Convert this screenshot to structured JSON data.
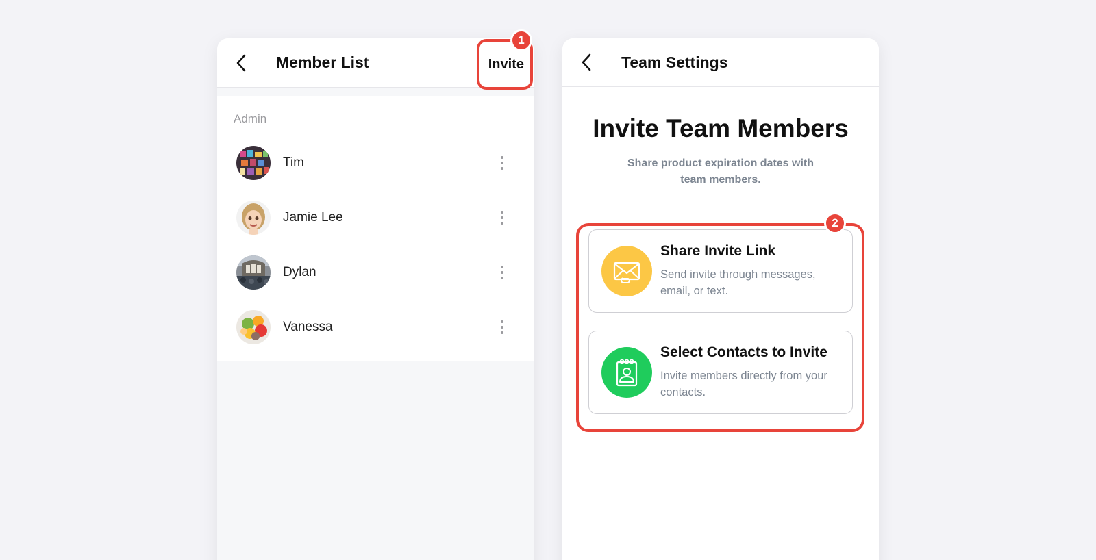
{
  "member_list": {
    "title": "Member List",
    "invite_label": "Invite",
    "section_label": "Admin",
    "members": [
      {
        "name": "Tim"
      },
      {
        "name": "Jamie Lee"
      },
      {
        "name": "Dylan"
      },
      {
        "name": "Vanessa"
      }
    ]
  },
  "team_settings": {
    "title": "Team Settings",
    "heading": "Invite Team Members",
    "subtitle": "Share product expiration dates with team members.",
    "options": [
      {
        "title": "Share Invite Link",
        "description": "Send invite through messages, email, or text.",
        "icon": "envelope-icon",
        "icon_color": "#fcc745"
      },
      {
        "title": "Select Contacts to Invite",
        "description": "Invite members directly from your contacts.",
        "icon": "contact-book-icon",
        "icon_color": "#1fcc5c"
      }
    ]
  },
  "callouts": [
    {
      "number": "1"
    },
    {
      "number": "2"
    }
  ],
  "colors": {
    "background": "#f3f3f7",
    "callout": "#e8443a",
    "secondary_text": "#7c8591"
  }
}
